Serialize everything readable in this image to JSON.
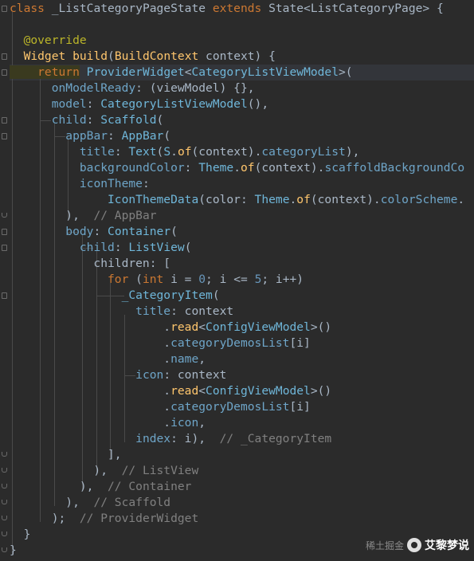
{
  "code_lines": [
    [
      [
        "kw",
        "class"
      ],
      [
        "plain",
        " _ListCategoryPageState "
      ],
      [
        "kw",
        "extends"
      ],
      [
        "plain",
        " State<ListCategoryPage> {"
      ]
    ],
    [],
    [
      [
        "ann",
        "  @override"
      ]
    ],
    [
      [
        "ty",
        "  Widget"
      ],
      [
        "plain",
        " "
      ],
      [
        "fn",
        "build"
      ],
      [
        "plain",
        "("
      ],
      [
        "ty",
        "BuildContext"
      ],
      [
        "plain",
        " context) {"
      ]
    ],
    [
      [
        "hl-kw",
        "    return"
      ],
      [
        "plain",
        " "
      ],
      [
        "cl",
        "ProviderWidget"
      ],
      [
        "plain",
        "<"
      ],
      [
        "cl",
        "CategoryListViewModel"
      ],
      [
        "plain",
        ">("
      ]
    ],
    [
      [
        "plain",
        "      "
      ],
      [
        "prop",
        "onModelReady"
      ],
      [
        "plain",
        ": (viewModel) {},"
      ]
    ],
    [
      [
        "plain",
        "      "
      ],
      [
        "prop",
        "model"
      ],
      [
        "plain",
        ": "
      ],
      [
        "cl",
        "CategoryListViewModel"
      ],
      [
        "plain",
        "(),"
      ]
    ],
    [
      [
        "plain",
        "      "
      ],
      [
        "prop",
        "child"
      ],
      [
        "plain",
        ": "
      ],
      [
        "cl",
        "Scaffold"
      ],
      [
        "plain",
        "("
      ]
    ],
    [
      [
        "plain",
        "        "
      ],
      [
        "prop",
        "appBar"
      ],
      [
        "plain",
        ": "
      ],
      [
        "cl",
        "AppBar"
      ],
      [
        "plain",
        "("
      ]
    ],
    [
      [
        "plain",
        "          "
      ],
      [
        "prop",
        "title"
      ],
      [
        "plain",
        ": "
      ],
      [
        "cl",
        "Text"
      ],
      [
        "plain",
        "("
      ],
      [
        "cl",
        "S"
      ],
      [
        "plain",
        "."
      ],
      [
        "fn",
        "of"
      ],
      [
        "plain",
        "(context)."
      ],
      [
        "prop",
        "categoryList"
      ],
      [
        "plain",
        "),"
      ]
    ],
    [
      [
        "plain",
        "          "
      ],
      [
        "prop",
        "backgroundColor"
      ],
      [
        "plain",
        ": "
      ],
      [
        "cl",
        "Theme"
      ],
      [
        "plain",
        "."
      ],
      [
        "fn",
        "of"
      ],
      [
        "plain",
        "(context)."
      ],
      [
        "prop",
        "scaffoldBackgroundCo"
      ]
    ],
    [
      [
        "plain",
        "          "
      ],
      [
        "prop",
        "iconTheme"
      ],
      [
        "plain",
        ":"
      ]
    ],
    [
      [
        "plain",
        "              "
      ],
      [
        "cl",
        "IconThemeData"
      ],
      [
        "plain",
        "(color: "
      ],
      [
        "cl",
        "Theme"
      ],
      [
        "plain",
        "."
      ],
      [
        "fn",
        "of"
      ],
      [
        "plain",
        "(context)."
      ],
      [
        "prop",
        "colorScheme"
      ],
      [
        "plain",
        "."
      ]
    ],
    [
      [
        "plain",
        "        ),  "
      ],
      [
        "cmt",
        "// AppBar"
      ]
    ],
    [
      [
        "plain",
        "        "
      ],
      [
        "prop",
        "body"
      ],
      [
        "plain",
        ": "
      ],
      [
        "cl",
        "Container"
      ],
      [
        "plain",
        "("
      ]
    ],
    [
      [
        "plain",
        "          "
      ],
      [
        "prop",
        "child"
      ],
      [
        "plain",
        ": "
      ],
      [
        "cl",
        "ListView"
      ],
      [
        "plain",
        "("
      ]
    ],
    [
      [
        "plain",
        "            children: ["
      ]
    ],
    [
      [
        "plain",
        "              "
      ],
      [
        "kw",
        "for"
      ],
      [
        "plain",
        " ("
      ],
      [
        "kw",
        "int"
      ],
      [
        "plain",
        " i = "
      ],
      [
        "num",
        "0"
      ],
      [
        "plain",
        "; i <= "
      ],
      [
        "num",
        "5"
      ],
      [
        "plain",
        "; i++)"
      ]
    ],
    [
      [
        "plain",
        "                "
      ],
      [
        "cl",
        "_CategoryItem"
      ],
      [
        "plain",
        "("
      ]
    ],
    [
      [
        "plain",
        "                  "
      ],
      [
        "prop",
        "title"
      ],
      [
        "plain",
        ": context"
      ]
    ],
    [
      [
        "plain",
        "                      ."
      ],
      [
        "fn",
        "read"
      ],
      [
        "plain",
        "<"
      ],
      [
        "cl",
        "ConfigViewModel"
      ],
      [
        "plain",
        ">()"
      ]
    ],
    [
      [
        "plain",
        "                      ."
      ],
      [
        "prop",
        "categoryDemosList"
      ],
      [
        "plain",
        "[i]"
      ]
    ],
    [
      [
        "plain",
        "                      ."
      ],
      [
        "prop",
        "name"
      ],
      [
        "plain",
        ","
      ]
    ],
    [
      [
        "plain",
        "                  "
      ],
      [
        "prop",
        "icon"
      ],
      [
        "plain",
        ": context"
      ]
    ],
    [
      [
        "plain",
        "                      ."
      ],
      [
        "fn",
        "read"
      ],
      [
        "plain",
        "<"
      ],
      [
        "cl",
        "ConfigViewModel"
      ],
      [
        "plain",
        ">()"
      ]
    ],
    [
      [
        "plain",
        "                      ."
      ],
      [
        "prop",
        "categoryDemosList"
      ],
      [
        "plain",
        "[i]"
      ]
    ],
    [
      [
        "plain",
        "                      ."
      ],
      [
        "prop",
        "icon"
      ],
      [
        "plain",
        ","
      ]
    ],
    [
      [
        "plain",
        "                  "
      ],
      [
        "prop",
        "index"
      ],
      [
        "plain",
        ": i),  "
      ],
      [
        "cmt",
        "// _CategoryItem"
      ]
    ],
    [
      [
        "plain",
        "              ],"
      ]
    ],
    [
      [
        "plain",
        "            ),  "
      ],
      [
        "cmt",
        "// ListView"
      ]
    ],
    [
      [
        "plain",
        "          ),  "
      ],
      [
        "cmt",
        "// Container"
      ]
    ],
    [
      [
        "plain",
        "        ),  "
      ],
      [
        "cmt",
        "// Scaffold"
      ]
    ],
    [
      [
        "plain",
        "      );  "
      ],
      [
        "cmt",
        "// ProviderWidget"
      ]
    ],
    [
      [
        "plain",
        "  }"
      ]
    ],
    [
      [
        "plain",
        "}"
      ]
    ]
  ],
  "watermark": {
    "text1": "稀土掘金",
    "text2": "艾黎梦说"
  }
}
